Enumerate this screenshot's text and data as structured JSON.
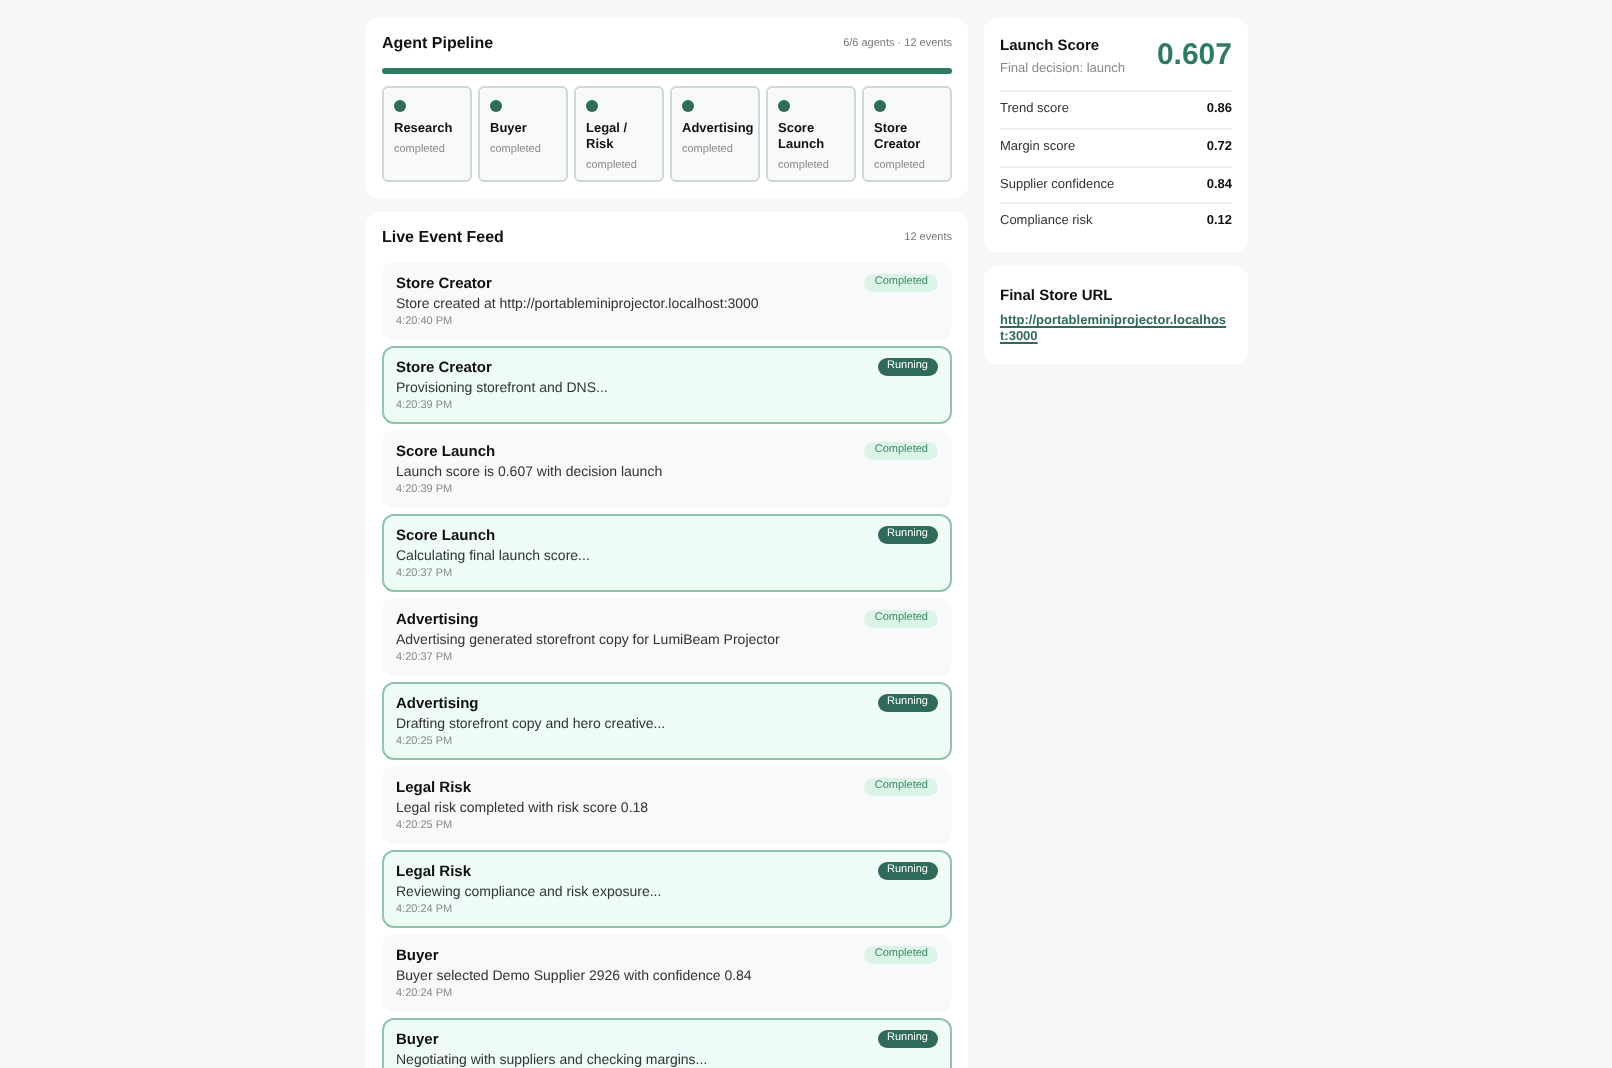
{
  "pipeline": {
    "title": "Agent Pipeline",
    "summary": "6/6 agents · 12 events",
    "level": 1,
    "agents": [
      {
        "name": "Research",
        "status": "completed",
        "done": true
      },
      {
        "name": "Buyer",
        "status": "completed",
        "done": true
      },
      {
        "name": "Legal / Risk",
        "status": "completed",
        "done": true
      },
      {
        "name": "Advertising",
        "status": "completed",
        "done": true
      },
      {
        "name": "Score Launch",
        "status": "completed",
        "done": true
      },
      {
        "name": "Store Creator",
        "status": "completed",
        "done": true
      }
    ]
  },
  "feed": {
    "title": "Live Event Feed",
    "count": "12 events",
    "events": [
      {
        "agent": "Store Creator",
        "kind": "completed",
        "badge": "Completed",
        "message": "Store created at http://portableminiprojector.localhost:3000",
        "time": "4:20:40 PM"
      },
      {
        "agent": "Store Creator",
        "kind": "running",
        "badge": "Running",
        "message": "Provisioning storefront and DNS...",
        "time": "4:20:39 PM"
      },
      {
        "agent": "Score Launch",
        "kind": "completed",
        "badge": "Completed",
        "message": "Launch score is 0.607 with decision launch",
        "time": "4:20:39 PM"
      },
      {
        "agent": "Score Launch",
        "kind": "running",
        "badge": "Running",
        "message": "Calculating final launch score...",
        "time": "4:20:37 PM"
      },
      {
        "agent": "Advertising",
        "kind": "completed",
        "badge": "Completed",
        "message": "Advertising generated storefront copy for LumiBeam Projector",
        "time": "4:20:37 PM"
      },
      {
        "agent": "Advertising",
        "kind": "running",
        "badge": "Running",
        "message": "Drafting storefront copy and hero creative...",
        "time": "4:20:25 PM"
      },
      {
        "agent": "Legal Risk",
        "kind": "completed",
        "badge": "Completed",
        "message": "Legal risk completed with risk score 0.18",
        "time": "4:20:25 PM"
      },
      {
        "agent": "Legal Risk",
        "kind": "running",
        "badge": "Running",
        "message": "Reviewing compliance and risk exposure...",
        "time": "4:20:24 PM"
      },
      {
        "agent": "Buyer",
        "kind": "completed",
        "badge": "Completed",
        "message": "Buyer selected Demo Supplier 2926 with confidence 0.84",
        "time": "4:20:24 PM"
      },
      {
        "agent": "Buyer",
        "kind": "running",
        "badge": "Running",
        "message": "Negotiating with suppliers and checking margins..."
      }
    ]
  },
  "launch": {
    "title": "Launch Score",
    "decision": "Final decision: launch",
    "score": "0.607",
    "metrics": [
      {
        "label": "Trend score",
        "value": "0.86"
      },
      {
        "label": "Margin score",
        "value": "0.72"
      },
      {
        "label": "Supplier confidence",
        "value": "0.84"
      },
      {
        "label": "Compliance risk",
        "value": "0.12"
      }
    ]
  },
  "store": {
    "title": "Final Store URL",
    "url": "http://portableminiprojector.localhost:3000"
  }
}
